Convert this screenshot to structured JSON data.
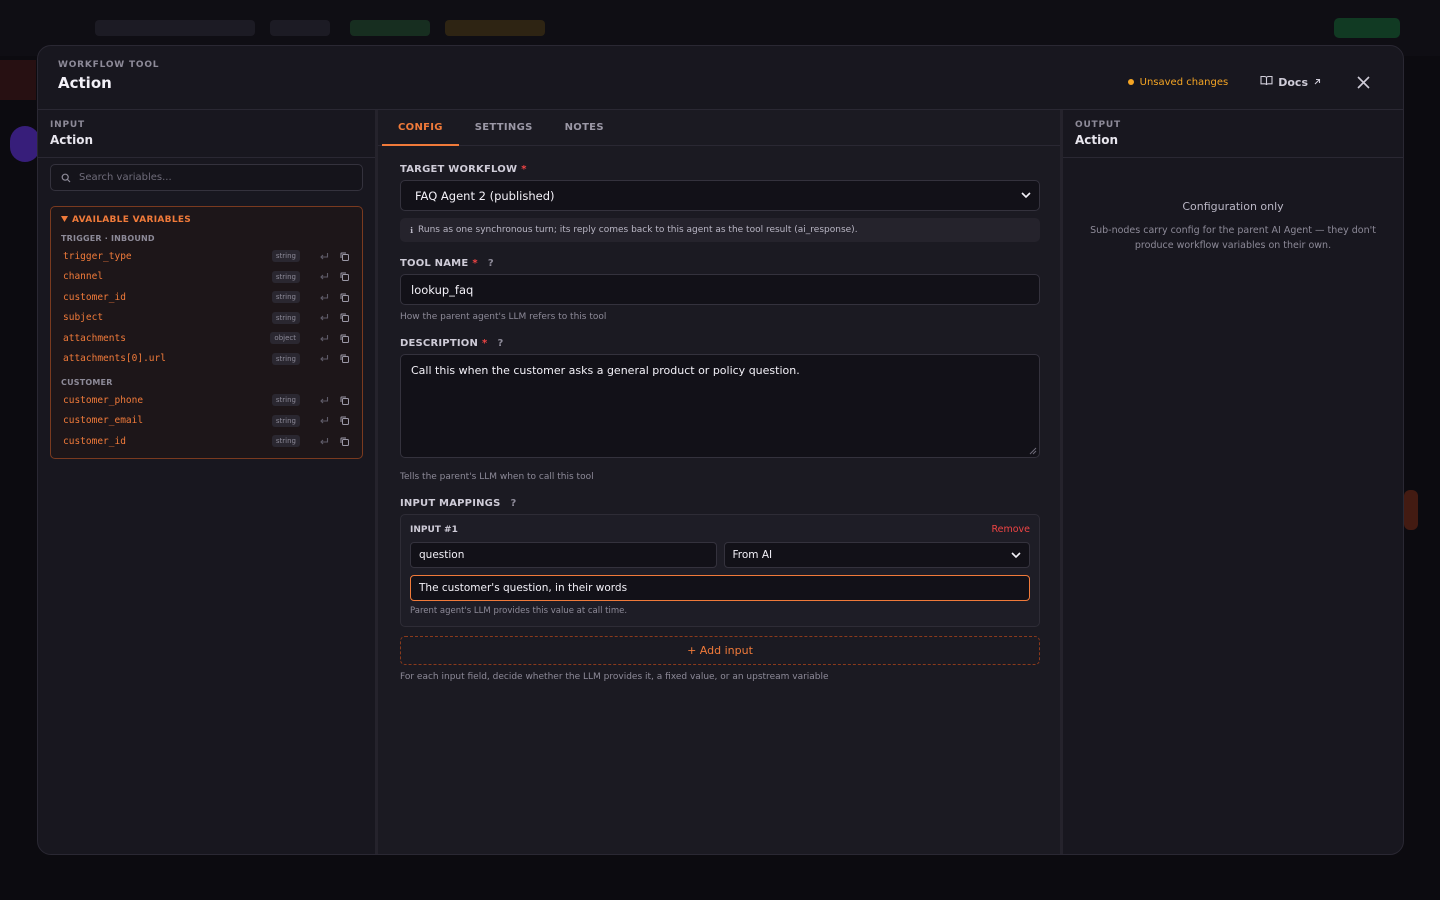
{
  "modal": {
    "eyebrow": "WORKFLOW TOOL",
    "title": "Action",
    "unsaved": "Unsaved changes",
    "docs": "Docs"
  },
  "input_pane": {
    "eyebrow": "INPUT",
    "title": "Action",
    "search_placeholder": "Search variables...",
    "available_label": "AVAILABLE VARIABLES",
    "groups": [
      {
        "label": "TRIGGER · INBOUND",
        "vars": [
          {
            "name": "trigger_type",
            "type": "string"
          },
          {
            "name": "channel",
            "type": "string"
          },
          {
            "name": "customer_id",
            "type": "string"
          },
          {
            "name": "subject",
            "type": "string"
          },
          {
            "name": "attachments",
            "type": "object"
          },
          {
            "name": "attachments[0].url",
            "type": "string"
          }
        ]
      },
      {
        "label": "CUSTOMER",
        "vars": [
          {
            "name": "customer_phone",
            "type": "string"
          },
          {
            "name": "customer_email",
            "type": "string"
          },
          {
            "name": "customer_id",
            "type": "string"
          }
        ]
      }
    ]
  },
  "config": {
    "tabs": [
      "CONFIG",
      "SETTINGS",
      "NOTES"
    ],
    "target_workflow": {
      "label": "TARGET WORKFLOW",
      "value": "FAQ Agent 2 (published)",
      "hint": "Runs as one synchronous turn; its reply comes back to this agent as the tool result (ai_response)."
    },
    "tool_name": {
      "label": "TOOL NAME",
      "value": "lookup_faq",
      "help": "How the parent agent's LLM refers to this tool"
    },
    "description": {
      "label": "DESCRIPTION",
      "value": "Call this when the customer asks a general product or policy question.",
      "help": "Tells the parent's LLM when to call this tool"
    },
    "input_mappings": {
      "label": "INPUT MAPPINGS",
      "items": [
        {
          "title": "INPUT #1",
          "remove": "Remove",
          "name": "question",
          "source": "From AI",
          "description": "The customer's question, in their words",
          "help": "Parent agent's LLM provides this value at call time."
        }
      ],
      "add_label": "+ Add input",
      "help": "For each input field, decide whether the LLM provides it, a fixed value, or an upstream variable"
    }
  },
  "output_pane": {
    "eyebrow": "OUTPUT",
    "title": "Action",
    "body_title": "Configuration only",
    "body_desc": "Sub-nodes carry config for the parent AI Agent — they don't produce workflow variables on their own."
  },
  "colors": {
    "accent": "#f07a3a",
    "warning": "#f5a524",
    "danger": "#ef4444"
  }
}
